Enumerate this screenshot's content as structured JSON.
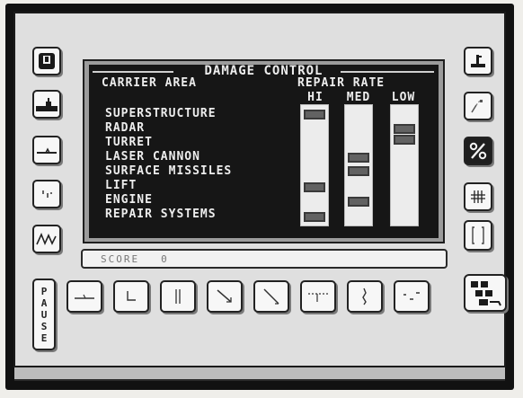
{
  "screen": {
    "title": "DAMAGE CONTROL",
    "carrier_area_header": "CARRIER AREA",
    "repair_rate_header": "REPAIR RATE",
    "rate_columns": [
      {
        "label": "HI"
      },
      {
        "label": "MED"
      },
      {
        "label": "LOW"
      }
    ],
    "carrier_areas": [
      {
        "name": "SUPERSTRUCTURE",
        "repair_rate": "HI"
      },
      {
        "name": "RADAR",
        "repair_rate": "LOW"
      },
      {
        "name": "TURRET",
        "repair_rate": "LOW"
      },
      {
        "name": "LASER CANNON",
        "repair_rate": "MED"
      },
      {
        "name": "SURFACE MISSILES",
        "repair_rate": "MED"
      },
      {
        "name": "LIFT",
        "repair_rate": "HI"
      },
      {
        "name": "ENGINE",
        "repair_rate": "MED"
      },
      {
        "name": "REPAIR SYSTEMS",
        "repair_rate": "HI"
      }
    ]
  },
  "score": {
    "label": "SCORE",
    "value": "0"
  },
  "pause": {
    "letters": [
      "P",
      "A",
      "U",
      "S",
      "E"
    ]
  },
  "left_buttons": [
    {
      "icon": "shield-icon"
    },
    {
      "icon": "carrier-icon"
    },
    {
      "icon": "aircraft-icon"
    },
    {
      "icon": "walrus-icon"
    },
    {
      "icon": "terrain-map-icon"
    }
  ],
  "right_buttons": [
    {
      "icon": "fuel-pump-icon"
    },
    {
      "icon": "repair-icon"
    },
    {
      "icon": "percent-icon"
    },
    {
      "icon": "grid-icon"
    },
    {
      "icon": "bracket-icon"
    },
    {
      "icon": "network-icon"
    }
  ],
  "bottom_buttons": [
    {
      "icon": "flat-line-icon"
    },
    {
      "icon": "corner-icon"
    },
    {
      "icon": "vertical-line-icon"
    },
    {
      "icon": "diagonal-arrow-icon"
    },
    {
      "icon": "diagonal-line-icon"
    },
    {
      "icon": "dashed-line-icon"
    },
    {
      "icon": "zigzag-icon"
    },
    {
      "icon": "scatter-icon"
    }
  ]
}
